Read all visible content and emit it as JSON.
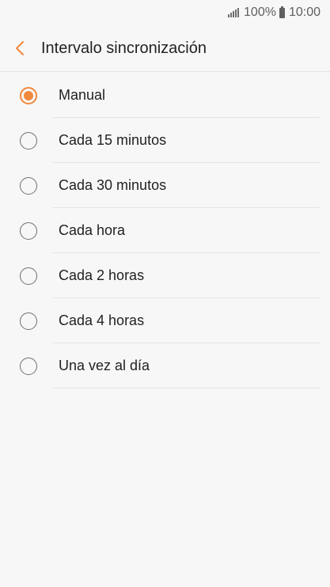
{
  "status": {
    "battery_text": "100%",
    "time": "10:00"
  },
  "header": {
    "title": "Intervalo sincronización",
    "back_icon": "chevron-left-icon"
  },
  "accent_color": "#f0883e",
  "options": [
    {
      "label": "Manual",
      "selected": true
    },
    {
      "label": "Cada 15 minutos",
      "selected": false
    },
    {
      "label": "Cada 30 minutos",
      "selected": false
    },
    {
      "label": "Cada hora",
      "selected": false
    },
    {
      "label": "Cada 2 horas",
      "selected": false
    },
    {
      "label": "Cada 4 horas",
      "selected": false
    },
    {
      "label": "Una vez al día",
      "selected": false
    }
  ]
}
